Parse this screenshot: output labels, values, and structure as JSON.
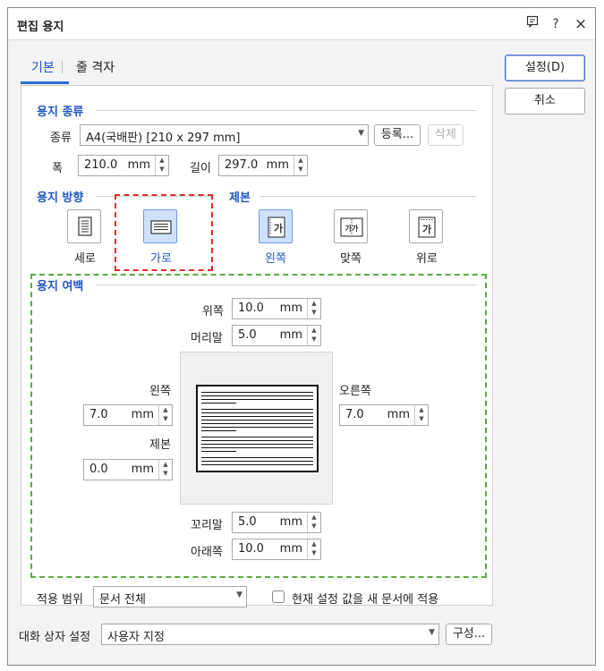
{
  "window": {
    "title": "편집 용지",
    "help_icon": "feedback-icon",
    "question_mark": "?",
    "close": "×"
  },
  "tabs": [
    {
      "label": "기본"
    },
    {
      "label": "줄 격자"
    }
  ],
  "side_buttons": {
    "ok": "설정(D)",
    "cancel": "취소"
  },
  "paper_type": {
    "section_title": "용지 종류",
    "type_label": "종류",
    "type_value": "A4(국배판) [210 x 297 mm]",
    "register_button": "등록...",
    "delete_button": "삭제",
    "width_label": "폭",
    "width_value": "210.0",
    "height_label": "길이",
    "height_value": "297.0",
    "unit": "mm"
  },
  "orientation": {
    "section_title": "용지 방향",
    "portrait": "세로",
    "landscape": "가로",
    "selected": "가로"
  },
  "binding": {
    "section_title": "제본",
    "left": "왼쪽",
    "facing": "맞쪽",
    "top": "위로",
    "selected": "왼쪽",
    "icon_glyph": "가",
    "facing_glyph": "가가"
  },
  "margins": {
    "section_title": "용지 여백",
    "top_label": "위쪽",
    "top_value": "10.0",
    "header_label": "머리말",
    "header_value": "5.0",
    "left_label": "왼쪽",
    "left_value": "7.0",
    "right_label": "오른쪽",
    "right_value": "7.0",
    "gutter_label": "제본",
    "gutter_value": "0.0",
    "footer_label": "꼬리말",
    "footer_value": "5.0",
    "bottom_label": "아래쪽",
    "bottom_value": "10.0",
    "unit": "mm"
  },
  "apply": {
    "scope_label": "적용 범위",
    "scope_value": "문서 전체",
    "checkbox_label": "현재 설정 값을 새 문서에 적용",
    "checkbox_checked": false
  },
  "dialog_settings": {
    "label": "대화 상자 설정",
    "value": "사용자 지정",
    "configure_button": "구성..."
  },
  "colors": {
    "accent": "#1f55c4",
    "highlight_red": "#d9312b",
    "highlight_green": "#59ab3f",
    "selected_fill": "#cfe0fb"
  }
}
